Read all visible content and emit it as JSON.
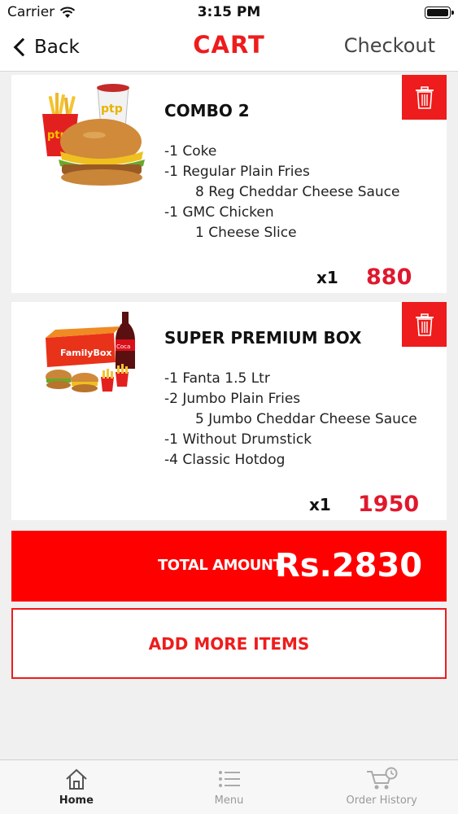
{
  "status_bar": {
    "carrier": "Carrier",
    "time": "3:15 PM"
  },
  "nav": {
    "back_label": "Back",
    "title": "CART",
    "checkout_label": "Checkout"
  },
  "items": [
    {
      "name": "COMBO 2",
      "lines": [
        "-1 Coke",
        "-1 Regular Plain Fries",
        "8 Reg Cheddar Cheese Sauce",
        "-1 GMC Chicken",
        "1 Cheese Slice"
      ],
      "quantity": "x1",
      "price": "880"
    },
    {
      "name": "SUPER PREMIUM BOX",
      "lines": [
        "-1 Fanta 1.5 Ltr",
        "-2 Jumbo Plain Fries",
        "5 Jumbo Cheddar Cheese Sauce",
        "-1 Without Drumstick",
        "-4 Classic Hotdog"
      ],
      "quantity": "x1",
      "price": "1950"
    }
  ],
  "total": {
    "label": "TOTAL AMOUNT",
    "value": "Rs.2830"
  },
  "add_more_label": "ADD MORE ITEMS",
  "tabs": [
    {
      "label": "Home",
      "icon": "home-icon"
    },
    {
      "label": "Menu",
      "icon": "menu-list-icon"
    },
    {
      "label": "Order History",
      "icon": "cart-clock-icon"
    }
  ],
  "colors": {
    "accent": "#ee1c1c",
    "total_bg": "#ff0000",
    "price": "#e0182d"
  }
}
